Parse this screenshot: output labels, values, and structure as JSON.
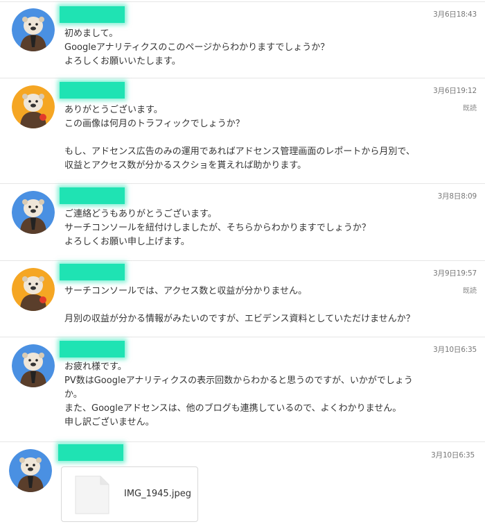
{
  "messages": [
    {
      "avatar": "user-a",
      "time": "3月6日18:43",
      "read": "",
      "lines": [
        "初めまして。",
        "Googleアナリティクスのこのページからわかりますでしょうか？",
        "よろしくお願いいたします。"
      ]
    },
    {
      "avatar": "user-b",
      "time": "3月6日19:12",
      "read": "既読",
      "lines": [
        "ありがとうございます。",
        "この画像は何月のトラフィックでしょうか？",
        "",
        "もし、アドセンス広告のみの運用であればアドセンス管理画面のレポートから月別で、",
        "収益とアクセス数が分かるスクショを貰えれば助かります。"
      ]
    },
    {
      "avatar": "user-a",
      "time": "3月8日8:09",
      "read": "",
      "lines": [
        "ご連絡どうもありがとうございます。",
        "サーチコンソールを紐付けしましたが、そちらからわかりますでしょうか？",
        "よろしくお願い申し上げます。"
      ]
    },
    {
      "avatar": "user-b",
      "time": "3月9日19:57",
      "read": "既読",
      "lines": [
        "サーチコンソールでは、アクセス数と収益が分かりません。",
        "",
        "月別の収益が分かる情報がみたいのですが、エビデンス資料としていただけませんか？"
      ]
    },
    {
      "avatar": "user-a",
      "time": "3月10日6:35",
      "read": "",
      "lines": [
        "お疲れ様です。",
        "PV数はGoogleアナリティクスの表示回数からわかると思うのですが、いかがでしょう",
        "か。",
        "また、Googleアドセンスは、他のブログも連携しているので、よくわかりません。",
        "申し訳ございません。"
      ]
    },
    {
      "avatar": "user-a",
      "time": "3月10日6:35",
      "read": "",
      "attachment": {
        "filename": "IMG_1945.jpeg",
        "icon": "file-icon"
      }
    }
  ],
  "colors": {
    "avatar_a_bg": "#4a90e2",
    "avatar_b_bg": "#f5a623",
    "name_redaction": "#1fe3b3"
  }
}
